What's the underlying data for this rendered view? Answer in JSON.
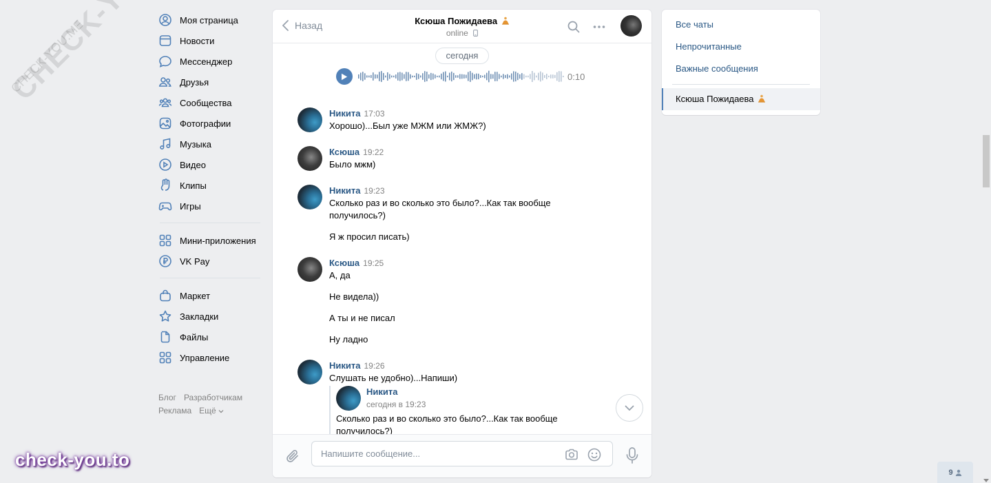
{
  "nav": {
    "items": [
      {
        "label": "Моя страница",
        "icon": "user-circle-icon"
      },
      {
        "label": "Новости",
        "icon": "newspaper-icon"
      },
      {
        "label": "Мессенджер",
        "icon": "message-bubble-icon"
      },
      {
        "label": "Друзья",
        "icon": "friends-icon"
      },
      {
        "label": "Сообщества",
        "icon": "communities-icon"
      },
      {
        "label": "Фотографии",
        "icon": "photo-icon"
      },
      {
        "label": "Музыка",
        "icon": "music-note-icon"
      },
      {
        "label": "Видео",
        "icon": "video-play-icon"
      },
      {
        "label": "Клипы",
        "icon": "clips-icon"
      },
      {
        "label": "Игры",
        "icon": "gamepad-icon"
      }
    ],
    "items2": [
      {
        "label": "Мини-приложения",
        "icon": "apps-grid-icon"
      },
      {
        "label": "VK Pay",
        "icon": "ruble-coin-icon"
      }
    ],
    "items3": [
      {
        "label": "Маркет",
        "icon": "shopping-bag-icon"
      },
      {
        "label": "Закладки",
        "icon": "star-icon"
      },
      {
        "label": "Файлы",
        "icon": "file-icon"
      },
      {
        "label": "Управление",
        "icon": "manage-grid-icon"
      }
    ],
    "footer": {
      "blog": "Блог",
      "developers": "Разработчикам",
      "ads": "Реклама",
      "more": "Ещё"
    }
  },
  "chat": {
    "back_label": "Назад",
    "peer_name": "Ксюша Пожидаева",
    "peer_status": "online",
    "date_label": "сегодня",
    "voice_duration": "0:10",
    "input_placeholder": "Напишите сообщение...",
    "messages": [
      {
        "author": "Никита",
        "time": "17:03",
        "texts": [
          "Хорошо)...Был уже МЖМ или ЖМЖ?)"
        ]
      },
      {
        "author": "Ксюша",
        "time": "19:22",
        "texts": [
          "Было мжм)"
        ]
      },
      {
        "author": "Никита",
        "time": "19:23",
        "texts": [
          "Сколько раз и во сколько это было?...Как так вообще получилось?)",
          "Я ж просил писать)"
        ]
      },
      {
        "author": "Ксюша",
        "time": "19:25",
        "texts": [
          "А, да",
          "Не видела))",
          "А ты и не писал",
          "Ну ладно"
        ]
      },
      {
        "author": "Никита",
        "time": "19:26",
        "texts": [
          "Слушать не удобно)...Напиши)"
        ]
      }
    ],
    "forwarded": {
      "author": "Никита",
      "time": "сегодня в 19:23",
      "text": "Сколько раз и во сколько это было?...Как так вообще получилось?)"
    }
  },
  "folders": {
    "all": "Все чаты",
    "unread": "Непрочитанные",
    "important": "Важные сообщения",
    "active_chat": "Ксюша Пожидаева"
  },
  "online_counter": "9",
  "watermarks": {
    "diagonal": "CHECK-YOU.ME",
    "brand": "check-you.to"
  },
  "colors": {
    "link": "#2a5885",
    "accent": "#5181b8",
    "background": "#edeef0"
  }
}
